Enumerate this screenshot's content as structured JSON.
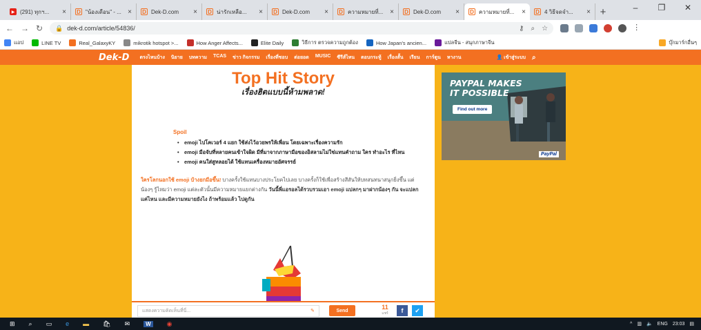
{
  "browser": {
    "tabs": [
      {
        "title": "(291) ทุกฯ...",
        "favicon": "youtube-icon",
        "active": false
      },
      {
        "title": "\"น้องเดือน\" - ...",
        "favicon": "dekd-icon",
        "active": false
      },
      {
        "title": "Dek-D.com",
        "favicon": "dekd-icon",
        "active": false
      },
      {
        "title": "น่ารักเหลือ...",
        "favicon": "dekd-icon",
        "active": false
      },
      {
        "title": "Dek-D.com",
        "favicon": "dekd-icon",
        "active": false
      },
      {
        "title": "ความหมายที่...",
        "favicon": "dekd-icon",
        "active": false
      },
      {
        "title": "Dek-D.com",
        "favicon": "dekd-icon",
        "active": false
      },
      {
        "title": "ความหมายที่...",
        "favicon": "dekd-icon",
        "active": true
      },
      {
        "title": "4 วิธีจดจำ...",
        "favicon": "dekd-icon",
        "active": false
      }
    ],
    "url": "dek-d.com/article/54836/"
  },
  "bookmarks": [
    {
      "label": "แอป",
      "icon": "apps-icon",
      "color": "#4285f4"
    },
    {
      "label": "LINE TV",
      "icon": "linetv-icon",
      "color": "#00b900"
    },
    {
      "label": "Real_GalaxyKY",
      "icon": "bookmark-icon",
      "color": "#f37021"
    },
    {
      "label": "mikrotik hotspot >...",
      "icon": "wifi-icon",
      "color": "#888"
    },
    {
      "label": "How Anger Affects...",
      "icon": "video-icon",
      "color": "#c4302b"
    },
    {
      "label": "Elite Daily",
      "icon": "elite-icon",
      "color": "#222"
    },
    {
      "label": "วิธีการ ตรวจความถูกต้อง",
      "icon": "globe-icon",
      "color": "#2e7d32"
    },
    {
      "label": "How Japan's ancien...",
      "icon": "video-icon",
      "color": "#1565c0"
    },
    {
      "label": "แปลจีน - สนุกภาษาจีน",
      "icon": "shield-icon",
      "color": "#6a1b9a"
    },
    {
      "label": "บุ๊กมาร์กอื่นๆ",
      "icon": "folder-icon",
      "color": "#f9a825"
    }
  ],
  "site_nav": {
    "logo": "Dek-D",
    "items": [
      "ตรงไหนบ้าง",
      "นิยาย",
      "บทความ",
      "TCAS",
      "ข่าว กิจกรรม",
      "เรื่องที่ชอบ",
      "ต่อยอด",
      "MUSIC",
      "ซีรีส์ไหน",
      "ตอบกระทู้",
      "เรื่องสั้น",
      "เรียน",
      "การ์ตูน",
      "หางาน"
    ],
    "login": "เข้าสู่ระบบ"
  },
  "article": {
    "title": "Top Hit Story",
    "subtitle": "เรื่องฮิตแบบนี้ห้ามพลาด!",
    "spoil_label": "Spoil",
    "bullets": [
      "emoji ไปโคเวอร์ 4 แยก ใช้ส่งไว้อวยพรให้เพื่อน โดยเฉพาะเรื่องความรัก",
      "emoji มือจับที่หลายคนเข้าใจผิด มีที่มาจากภาษามือของอิสลามไม่ใช่แทนคำถาม ใคร ทำอะไร ที่ไหน",
      "emoji คนใส่สูทลอยได้ ใช้แทนเครื่องหมายอัศจรรย์"
    ],
    "para_highlight": "ใครโลกนอกใช้ emoji บ้างยกมือขึ้น!",
    "para_text": " บางครั้งใช้แทนบางประโยคไปเลย บางครั้งก็ใช้เพื่อสร้างสีสันให้บทสนทนาสนุกยิ่งขึ้น แต่น้องๆ รู้ไหมว่า emoji แต่ละตัวนั้นมีความหมายแยกต่างกัน ",
    "para_bold": "วันนี้พี่แอรอลได้รวบรวมเอา emoji แปลกๆ มาฝากน้องๆ กัน จะแปลกแค่ไหน และมีความหมายยังไง ถ้าพร้อมแล้ว ไปดูกัน"
  },
  "comment_bar": {
    "placeholder": "แสดงความคิดเห็นที่นี่...",
    "send_label": "Send",
    "share_count": "11",
    "share_label": "แชร์"
  },
  "ad": {
    "headline_1": "PAYPAL MAKES",
    "headline_2": "IT POSSIBLE",
    "cta": "Find out more",
    "brand": "PayPal"
  },
  "taskbar": {
    "lang": "ENG",
    "time": "23:03"
  },
  "colors": {
    "brand_orange": "#f37021",
    "page_bg": "#f7b318"
  }
}
